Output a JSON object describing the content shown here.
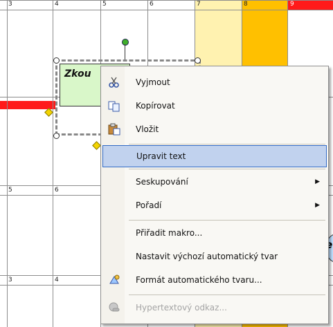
{
  "calendar": {
    "top_row_days": [
      "3",
      "4",
      "5",
      "6",
      "7",
      "8",
      "9"
    ],
    "row2_days": [
      "5",
      "6"
    ],
    "row3_days": [
      "3",
      "4"
    ],
    "colors": {
      "highlight_yellow": "#fff2b0",
      "highlight_orange": "#ffc000",
      "red_band": "#ff1a1a",
      "grid": "#8c8c8c"
    }
  },
  "shape": {
    "text": "Zkou",
    "fill": "#d9f7c9"
  },
  "partial_shape_text": "e",
  "context_menu": {
    "items": [
      {
        "label": "Vyjmout",
        "icon": "scissors-icon",
        "enabled": true
      },
      {
        "label": "Kopírovat",
        "icon": "copy-icon",
        "enabled": true
      },
      {
        "label": "Vložit",
        "icon": "paste-icon",
        "enabled": true
      },
      {
        "label": "Upravit text",
        "icon": "",
        "enabled": true,
        "highlighted": true
      },
      {
        "label": "Seskupování",
        "icon": "",
        "enabled": true,
        "submenu": true
      },
      {
        "label": "Pořadí",
        "icon": "",
        "enabled": true,
        "submenu": true
      },
      {
        "label": "Přiřadit makro...",
        "icon": "",
        "enabled": true
      },
      {
        "label": "Nastavit výchozí automatický tvar",
        "icon": "",
        "enabled": true
      },
      {
        "label": "Formát automatického tvaru...",
        "icon": "format-shape-icon",
        "enabled": true
      },
      {
        "label": "Hypertextový odkaz...",
        "icon": "hyperlink-icon",
        "enabled": false
      }
    ],
    "submenu_arrow": "▶"
  }
}
